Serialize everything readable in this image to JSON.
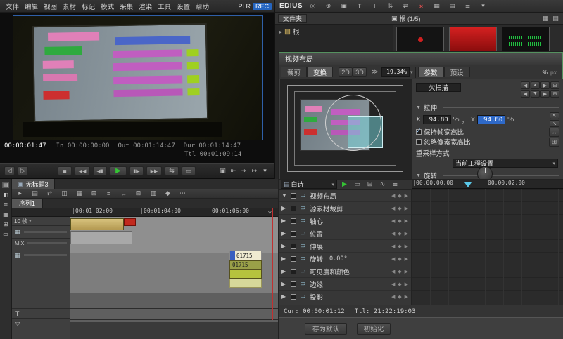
{
  "menubar": {
    "items": [
      "文件",
      "编辑",
      "视图",
      "素材",
      "标记",
      "模式",
      "采集",
      "渲染",
      "工具",
      "设置",
      "帮助"
    ],
    "plr": "PLR",
    "rec": "REC"
  },
  "titlebar": {
    "app": "EDIUS",
    "icons": [
      "◎",
      "⊕",
      "▣",
      "T",
      "＋",
      "⇅",
      "⇄",
      "×",
      "▦",
      "▤",
      "≣",
      "▾"
    ]
  },
  "bin": {
    "panel_tab": "文件夹",
    "clips_tab": "根 (1/5)",
    "clips_tab_icon": "▣",
    "root": "根",
    "root_icon": "▤",
    "root_expander": "▸",
    "view_icons": [
      "▦",
      "▤"
    ]
  },
  "preview": {
    "tc": "00:00:01:47",
    "in": "In 00:00:00:00",
    "out": "Out 00:01:14:47",
    "dur": "Dur 00:01:14:47",
    "ttl": "Ttl 00:01:09:14",
    "jog": [
      "◁",
      "▷"
    ],
    "transport_left": [
      "■",
      "◀◀",
      "◀▮"
    ],
    "play": "▶",
    "transport_right": [
      "▮▶",
      "▶▶",
      "⇆",
      "▭"
    ],
    "right_icons": [
      "▣",
      "⇤",
      "⇥",
      "↦",
      "▾"
    ]
  },
  "dlg": {
    "title": "视频布局",
    "tab_crop": "裁剪",
    "tab_transform": "变换",
    "mode_2d": "2D",
    "mode_3d": "3D",
    "chevrons": "≫",
    "zoom": "19.34%",
    "zoom_dd": "▾",
    "tab_params": "参数",
    "tab_presets": "预设",
    "pct": "%",
    "px": "px",
    "pad_row1": [
      "◀",
      "▲",
      "▶",
      "⊞"
    ],
    "pad_row2": [
      "◀",
      "▼",
      "▶",
      "⊟"
    ],
    "underscan": "欠扫描",
    "sec_arrow": "▼",
    "sec_stretch": "拉伸",
    "x_label": "X",
    "x_value": "94.80",
    "sep": "，",
    "y_label": "Y",
    "y_value": "94.80",
    "unit": "%",
    "check": "✓",
    "keep_aspect": "保持帧宽高比",
    "ignore_pixel": "忽略像素宽高比",
    "side_btns1": [
      "↖",
      "↘"
    ],
    "side_btns2": [
      "↔",
      "⊞"
    ],
    "resample_label": "重采样方式",
    "resample_value": "当前工程设置",
    "sec_rotate": "旋转",
    "combo_icon": "▤",
    "combo": "白诗",
    "combo_dd": "▾",
    "kf_play": "▶",
    "kf_icons": [
      "▭",
      "⊟",
      "∿",
      "≣"
    ],
    "ruler": [
      "00:00:00:00",
      "00:00:02:00"
    ],
    "tree": [
      {
        "exp": "▼",
        "icon": "⊃",
        "label": "视频布局",
        "value": ""
      },
      {
        "exp": "▶",
        "icon": "⊃",
        "label": "源素材裁剪",
        "value": ""
      },
      {
        "exp": "▶",
        "icon": "⊃",
        "label": "轴心",
        "value": ""
      },
      {
        "exp": "▶",
        "icon": "⊃",
        "label": "位置",
        "value": ""
      },
      {
        "exp": "▶",
        "icon": "⊃",
        "label": "伸展",
        "value": ""
      },
      {
        "exp": "▶",
        "icon": "⊃",
        "label": "旋转",
        "value": "0.00°"
      },
      {
        "exp": "▶",
        "icon": "⊃",
        "label": "可见度和颜色",
        "value": ""
      },
      {
        "exp": "▶",
        "icon": "⊃",
        "label": "边缘",
        "value": ""
      },
      {
        "exp": "▶",
        "icon": "⊃",
        "label": "投影",
        "value": ""
      }
    ],
    "kf_nav": "◀ ◆ ▶",
    "cur": "Cur: 00:00:01:12",
    "ttl": "Ttl: 21:22:19:03",
    "btn_save": "存为默认",
    "btn_init": "初始化"
  },
  "timeline": {
    "panel_tab_icon": "▣",
    "panel_tab": "无标题3",
    "toolbar": [
      "▸",
      "▤",
      "⇄",
      "◫",
      "▦",
      "⊞",
      "≡",
      "↔",
      "⊟",
      "▥",
      "◆",
      "⋯"
    ],
    "seq_tab": "序列1",
    "ruler": [
      "00:01:02:00",
      "00:01:04:00",
      "00:01:06:00"
    ],
    "scale": "10 帧",
    "scale_dd": "▾",
    "track_icon1": "▦",
    "mix": "MIX",
    "track_icon2": "▦",
    "t_label": "T",
    "marker": "▽",
    "clip1": "01715",
    "clip2": "01715",
    "left_icons": [
      "▤",
      "◧",
      "≣",
      "▦",
      "⊞",
      "▭"
    ]
  }
}
